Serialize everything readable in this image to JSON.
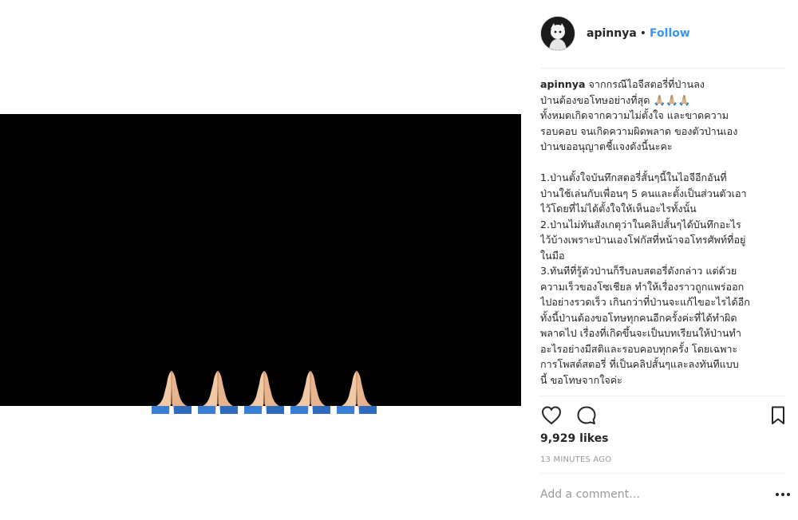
{
  "post": {
    "username": "apinnya",
    "separator": "•",
    "follow_label": "Follow",
    "caption_user": "apinnya",
    "caption_text": " จากกรณีไอจีสตอรี่ที่ป่านลง\nป่านต้องขอโทษอย่างที่สุด 🙏🏼🙏🏼🙏🏼\nทั้งหมดเกิดจากความไม่ตั้งใจ และขาดความ\nรอบคอบ จนเกิดความผิดพลาด ของตัวป่านเอง\nป่านขออนุญาตชี้แจงดังนี้นะคะ\n\n1.ป่านตั้งใจบันทึกสตอรี่สั้นๆนี้ในไอจีอีกอันที่\nป่านใช้เล่นกับเพื่อนๆ 5 คนและตั้งเป็นส่วนตัวเอา\nไว้โดยที่ไม่ได้ตั้งใจให้เห็นอะไรทั้งนั้น\n2.ป่านไม่ทันสังเกตุว่าในคลิปสั้นๆได้บันทึกอะไร\nไว้บ้างเพราะป่านเองโฟกัสที่หน้าจอโทรศัพท์ที่อยู่\nในมือ\n3.ทันทีที่รู้ตัวป่านก็รีบลบสตอรี่ดังกล่าว แต่ด้วย\nความเร็วของโซเชียล ทำให้เรื่องราวถูกแพร่ออก\nไปอย่างรวดเร็ว เกินกว่าที่ป่านจะแก้ไขอะไรได้อีก\nทั้งนี้ป่านต้องขอโทษทุกคนอีกครั้งค่ะที่ได้ทำผิด\nพลาดไป เรื่องที่เกิดขึ้นจะเป็นบทเรียนให้ป่านทำ\nอะไรอย่างมีสติและรอบคอบทุกครั้ง โดยเฉพาะ\nการโพสต์สตอรี่ ที่เป็นคลิปสั้นๆและลงทันทีแบบ\nนี้ ขอโทษจากใจค่ะ",
    "likes": "9,929 likes",
    "timestamp": "13 MINUTES AGO",
    "comment_placeholder": "Add a comment…",
    "more_label": "•••"
  },
  "icons": {
    "like": "heart-outline-icon",
    "comment": "speech-bubble-icon",
    "save": "bookmark-outline-icon",
    "more": "ellipsis-icon",
    "media_content": "folded-hands-emoji"
  },
  "colors": {
    "follow": "#3897f0",
    "text": "#262626",
    "muted": "#999999",
    "divider": "#efefef",
    "media_background": "#000000",
    "skin": "#f1c9a5",
    "sleeve": "#3a7fd5"
  }
}
